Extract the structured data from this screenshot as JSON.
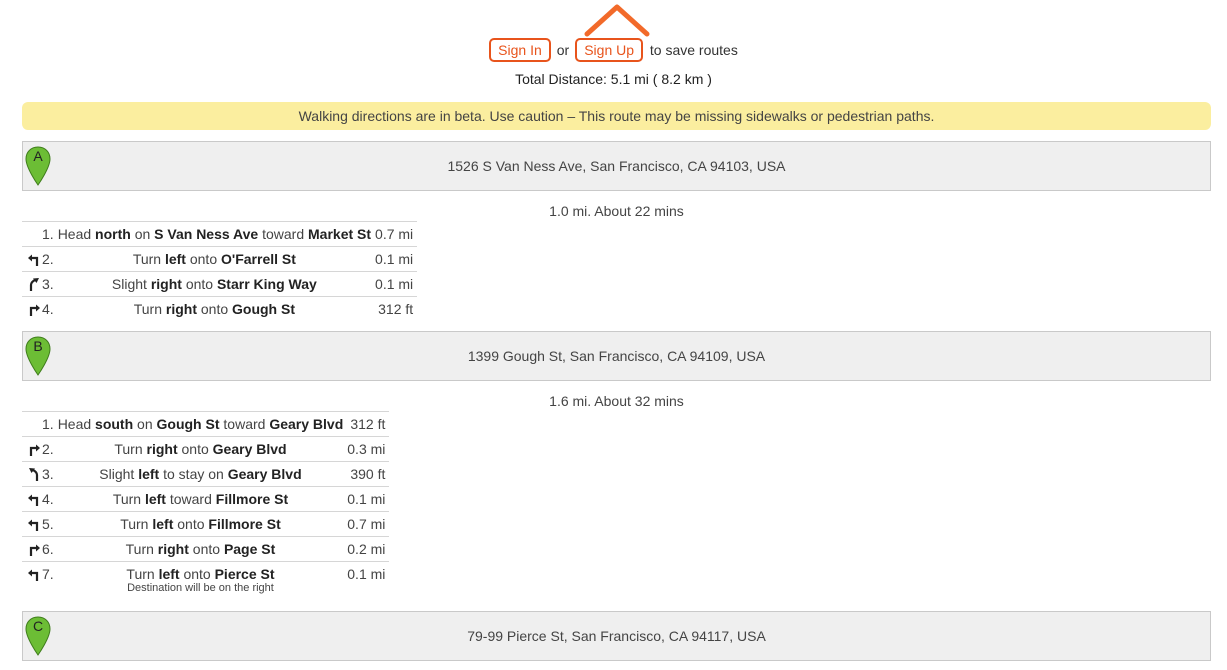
{
  "auth": {
    "signin_label": "Sign In",
    "or_text": "or",
    "signup_label": "Sign Up",
    "suffix_text": "to save routes"
  },
  "total_distance": "Total Distance: 5.1 mi ( 8.2 km )",
  "beta_notice": "Walking directions are in beta. Use caution – This route may be missing sidewalks or pedestrian paths.",
  "colors": {
    "accent": "#e8541c",
    "pin": "#6cbd35",
    "beta_bg": "#fbee9f",
    "waypoint_bg": "#efefef"
  },
  "waypoints": [
    {
      "letter": "A",
      "address": "1526 S Van Ness Ave, San Francisco, CA 94103, USA"
    },
    {
      "letter": "B",
      "address": "1399 Gough St, San Francisco, CA 94109, USA"
    },
    {
      "letter": "C",
      "address": "79-99 Pierce St, San Francisco, CA 94117, USA"
    }
  ],
  "legs": [
    {
      "summary": "1.0 mi. About 22 mins",
      "steps": [
        {
          "num": "1.",
          "icon": "none",
          "parts": [
            [
              "Head ",
              false
            ],
            [
              "north",
              true
            ],
            [
              " on ",
              false
            ],
            [
              "S Van Ness Ave",
              true
            ],
            [
              " toward ",
              false
            ],
            [
              "Market St",
              true
            ]
          ],
          "dist": "0.7 mi"
        },
        {
          "num": "2.",
          "icon": "turn-left-icon",
          "parts": [
            [
              "Turn ",
              false
            ],
            [
              "left",
              true
            ],
            [
              " onto ",
              false
            ],
            [
              "O'Farrell St",
              true
            ]
          ],
          "dist": "0.1 mi"
        },
        {
          "num": "3.",
          "icon": "slight-right-icon",
          "parts": [
            [
              "Slight ",
              false
            ],
            [
              "right",
              true
            ],
            [
              " onto ",
              false
            ],
            [
              "Starr King Way",
              true
            ]
          ],
          "dist": "0.1 mi"
        },
        {
          "num": "4.",
          "icon": "turn-right-icon",
          "parts": [
            [
              "Turn ",
              false
            ],
            [
              "right",
              true
            ],
            [
              " onto ",
              false
            ],
            [
              "Gough St",
              true
            ]
          ],
          "dist": "312 ft"
        }
      ]
    },
    {
      "summary": "1.6 mi. About 32 mins",
      "steps": [
        {
          "num": "1.",
          "icon": "none",
          "parts": [
            [
              "Head ",
              false
            ],
            [
              "south",
              true
            ],
            [
              " on ",
              false
            ],
            [
              "Gough St",
              true
            ],
            [
              " toward ",
              false
            ],
            [
              "Geary Blvd",
              true
            ]
          ],
          "dist": "312 ft"
        },
        {
          "num": "2.",
          "icon": "turn-right-icon",
          "parts": [
            [
              "Turn ",
              false
            ],
            [
              "right",
              true
            ],
            [
              " onto ",
              false
            ],
            [
              "Geary Blvd",
              true
            ]
          ],
          "dist": "0.3 mi"
        },
        {
          "num": "3.",
          "icon": "slight-left-icon",
          "parts": [
            [
              "Slight ",
              false
            ],
            [
              "left",
              true
            ],
            [
              " to stay on ",
              false
            ],
            [
              "Geary Blvd",
              true
            ]
          ],
          "dist": "390 ft"
        },
        {
          "num": "4.",
          "icon": "turn-left-icon",
          "parts": [
            [
              "Turn ",
              false
            ],
            [
              "left",
              true
            ],
            [
              " toward ",
              false
            ],
            [
              "Fillmore St",
              true
            ]
          ],
          "dist": "0.1 mi"
        },
        {
          "num": "5.",
          "icon": "turn-left-icon",
          "parts": [
            [
              "Turn ",
              false
            ],
            [
              "left",
              true
            ],
            [
              " onto ",
              false
            ],
            [
              "Fillmore St",
              true
            ]
          ],
          "dist": "0.7 mi"
        },
        {
          "num": "6.",
          "icon": "turn-right-icon",
          "parts": [
            [
              "Turn ",
              false
            ],
            [
              "right",
              true
            ],
            [
              " onto ",
              false
            ],
            [
              "Page St",
              true
            ]
          ],
          "dist": "0.2 mi"
        },
        {
          "num": "7.",
          "icon": "turn-left-icon",
          "parts": [
            [
              "Turn ",
              false
            ],
            [
              "left",
              true
            ],
            [
              " onto ",
              false
            ],
            [
              "Pierce St",
              true
            ]
          ],
          "note": "Destination will be on the right",
          "dist": "0.1 mi"
        }
      ]
    }
  ]
}
